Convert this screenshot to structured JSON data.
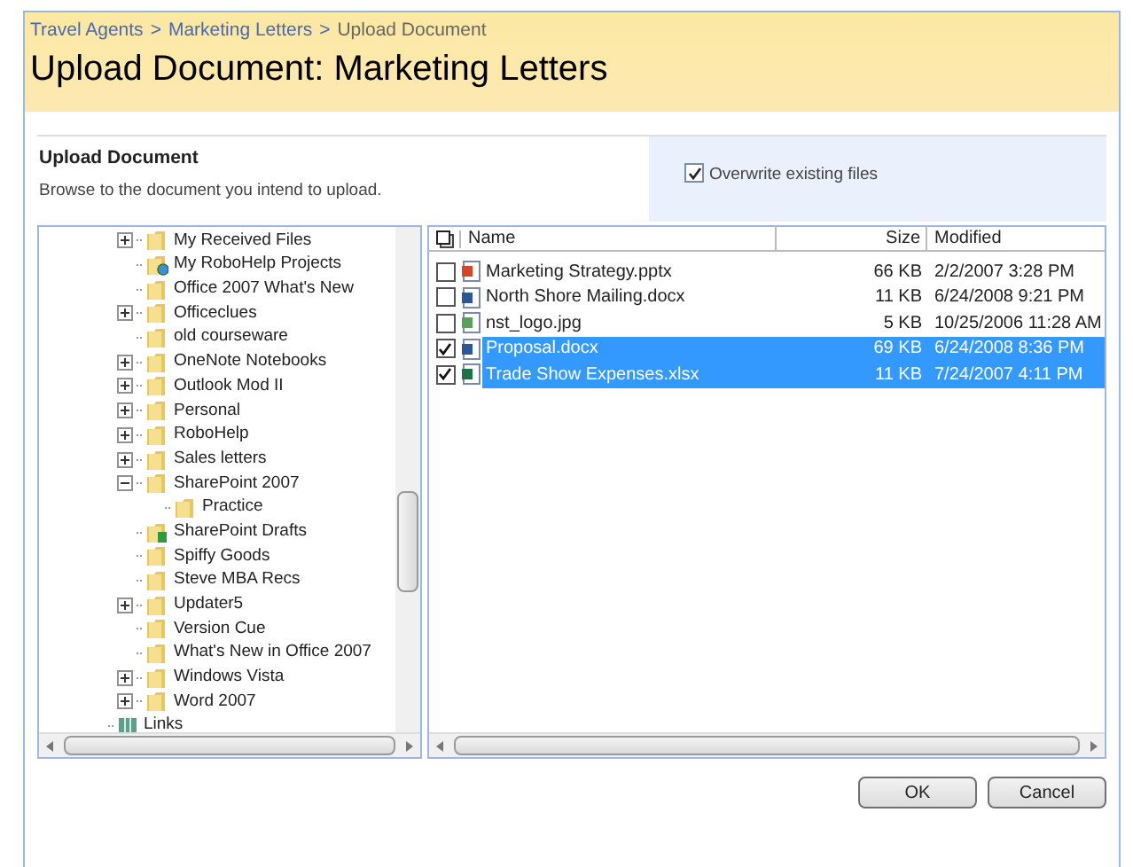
{
  "breadcrumb": [
    {
      "label": "Travel Agents"
    },
    {
      "label": ">"
    },
    {
      "label": "Marketing Letters"
    },
    {
      "label": ">"
    },
    {
      "label": "Upload Document"
    }
  ],
  "page_title": "Upload Document: Marketing Letters",
  "section": {
    "title": "Upload Document",
    "description": "Browse to the document you intend to upload.",
    "overwrite": {
      "label": "Overwrite existing files",
      "checked": true
    }
  },
  "tree": {
    "items": [
      {
        "children": [
          {
            "label": "My Received Files",
            "kind": "folder",
            "expanded": false
          },
          {
            "label": "My RoboHelp Projects",
            "kind": "web-folder"
          },
          {
            "label": "Office 2007 What's New",
            "kind": "folder"
          },
          {
            "label": "Officeclues",
            "kind": "folder",
            "expanded": false
          },
          {
            "label": "old courseware",
            "kind": "folder"
          },
          {
            "label": "OneNote Notebooks",
            "kind": "folder",
            "expanded": false
          },
          {
            "label": "Outlook Mod II",
            "kind": "folder",
            "expanded": false
          },
          {
            "label": "Personal",
            "kind": "folder",
            "expanded": false
          },
          {
            "label": "RoboHelp",
            "kind": "folder",
            "expanded": false
          },
          {
            "label": "Sales letters",
            "kind": "folder",
            "expanded": false
          },
          {
            "label": "SharePoint 2007",
            "kind": "folder",
            "expanded": true,
            "children": [
              {
                "label": "Practice",
                "kind": "folder"
              }
            ]
          },
          {
            "label": "SharePoint Drafts",
            "kind": "sheet-folder"
          },
          {
            "label": "Spiffy Goods",
            "kind": "folder"
          },
          {
            "label": "Steve MBA Recs",
            "kind": "folder"
          },
          {
            "label": "Updater5",
            "kind": "folder",
            "expanded": false
          },
          {
            "label": "Version Cue",
            "kind": "folder"
          },
          {
            "label": "What's New in Office 2007",
            "kind": "folder"
          },
          {
            "label": "Windows Vista",
            "kind": "folder",
            "expanded": false
          },
          {
            "label": "Word 2007",
            "kind": "folder",
            "expanded": false
          }
        ]
      },
      {
        "label": "Links",
        "kind": "library"
      }
    ]
  },
  "files": {
    "columns": [
      "Name",
      "Size",
      "Modified"
    ],
    "rows": [
      {
        "name": "Marketing Strategy.pptx",
        "kind": "pptx",
        "size": "66 KB",
        "modified": "2/2/2007 3:28 PM",
        "checked": false,
        "selected": false
      },
      {
        "name": "North Shore Mailing.docx",
        "kind": "docx",
        "size": "11 KB",
        "modified": "6/24/2008 9:21 PM",
        "checked": false,
        "selected": false
      },
      {
        "name": "nst_logo.jpg",
        "kind": "jpg",
        "size": "5 KB",
        "modified": "10/25/2006 11:28 AM",
        "checked": false,
        "selected": false
      },
      {
        "name": "Proposal.docx",
        "kind": "docx",
        "size": "69 KB",
        "modified": "6/24/2008 8:36 PM",
        "checked": true,
        "selected": true
      },
      {
        "name": "Trade Show Expenses.xlsx",
        "kind": "xlsx",
        "size": "11 KB",
        "modified": "7/24/2007 4:11 PM",
        "checked": true,
        "selected": true
      }
    ]
  },
  "buttons": [
    {
      "label": "OK"
    },
    {
      "label": "Cancel"
    }
  ]
}
